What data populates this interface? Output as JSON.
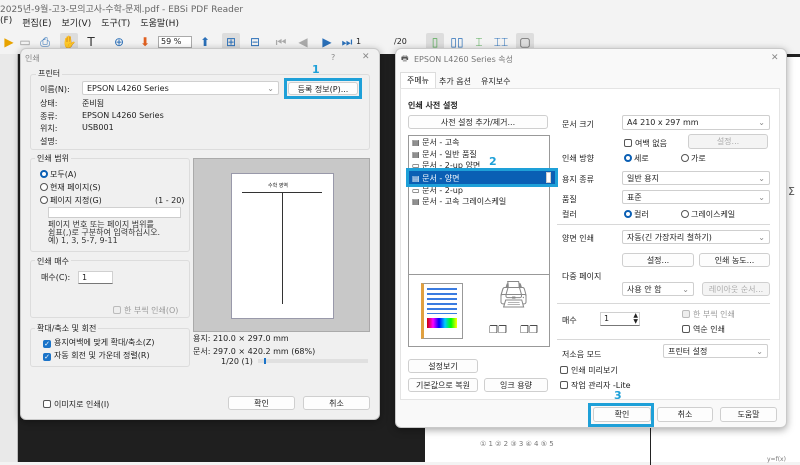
{
  "app": {
    "title": "2025년-9월-고3-모의고사-수학-문제.pdf - EBSi PDF Reader",
    "menu": [
      "(F)",
      "편집(E)",
      "보기(V)",
      "도구(T)",
      "도움말(H)"
    ],
    "toolbar": {
      "zoom": "59 %",
      "page": "1",
      "total": "/20",
      "page_total_right": "1/20"
    }
  },
  "print_dialog": {
    "title": "인쇄",
    "help": "?",
    "close": "✕",
    "printer": {
      "group": "프린터",
      "name_label": "이름(N):",
      "name_value": "EPSON L4260 Series",
      "props_button": "등록 정보(P)...",
      "status_label": "상태:",
      "status_value": "준비됨",
      "type_label": "종류:",
      "type_value": "EPSON L4260 Series",
      "where_label": "위치:",
      "where_value": "USB001",
      "comment_label": "설명:"
    },
    "range": {
      "group": "인쇄 범위",
      "all": "모두(A)",
      "current": "현재 페이지(S)",
      "pages": "페이지 지정(G)",
      "pages_range": "(1 - 20)",
      "pages_value": "",
      "help": [
        "페이지 번호 또는 페이지 범위를",
        "쉼표(,)로 구분하여 입력하십시오.",
        "예) 1, 3, 5-7, 9-11"
      ]
    },
    "copies": {
      "group": "인쇄 매수",
      "label": "매수(C):",
      "value": "1",
      "collate": "한 부씩 인쇄(O)"
    },
    "scale": {
      "group": "확대/축소 및 회전",
      "fit": "용지여백에 맞게 확대/축소(Z)",
      "rotate": "자동 회전 및 가운데 정렬(R)"
    },
    "preview": {
      "paper": "용지: 210.0 × 297.0 mm",
      "doc": "문서: 297.0 × 420.2 mm (68%)",
      "page": "1/20 (1)",
      "page_fraction": 0.05,
      "preview_title": "수학 영역"
    },
    "as_image": "이미지로 인쇄(I)",
    "ok": "확인",
    "cancel": "취소"
  },
  "props_dialog": {
    "title": "EPSON L4260 Series 속성",
    "close": "✕",
    "tabs": [
      "주메뉴",
      "추가 옵션",
      "유지보수"
    ],
    "preset_heading": "인쇄 사전 설정",
    "preset_button": "사전 설정 추가/제거...",
    "presets": [
      "문서 - 고속",
      "문서 - 일반 품질",
      "문서 - 2-up 양면",
      "문서 - 양면",
      "문서 - 2-up",
      "문서 - 고속 그레이스케일"
    ],
    "show_settings": "설정보기",
    "reset": "기본값으로 복원",
    "ink": "잉크 용량",
    "doc_size_label": "문서 크기",
    "doc_size": "A4 210 x 297 mm",
    "borderless": "여백 없음",
    "borderless_settings": "설정...",
    "orientation_label": "인쇄 방향",
    "portrait": "세로",
    "landscape": "가로",
    "paper_label": "용지 종류",
    "paper": "일반 용지",
    "quality_label": "품질",
    "quality": "표준",
    "color_label": "컬러",
    "color": "컬러",
    "grayscale": "그레이스케일",
    "duplex_label": "양면 인쇄",
    "duplex": "자동(긴 가장자리 철하기)",
    "duplex_settings": "설정...",
    "density": "인쇄 농도...",
    "multipage_label": "다중 페이지",
    "multipage": "사용 안 함",
    "layout_order": "레이아웃 순서...",
    "copies_label": "매수",
    "copies": "1",
    "collate": "한 부씩 인쇄",
    "reverse": "역순 인쇄",
    "quiet_label": "저소음 모드",
    "quiet": "프린터 설정",
    "preview": "인쇄 미리보기",
    "job_arranger": "작업 관리자 -Lite",
    "ok": "확인",
    "cancel": "취소",
    "help": "도움말"
  },
  "annotations": [
    "1",
    "2",
    "3"
  ],
  "background_page": {
    "choices": "① 1    ② 2    ③ 3    ④ 4    ⑤ 5",
    "sigma": "Σ",
    "fx": "y=f(x)"
  },
  "colors": {
    "highlight": "#1ea0d8",
    "selected": "#0a5fb4"
  }
}
